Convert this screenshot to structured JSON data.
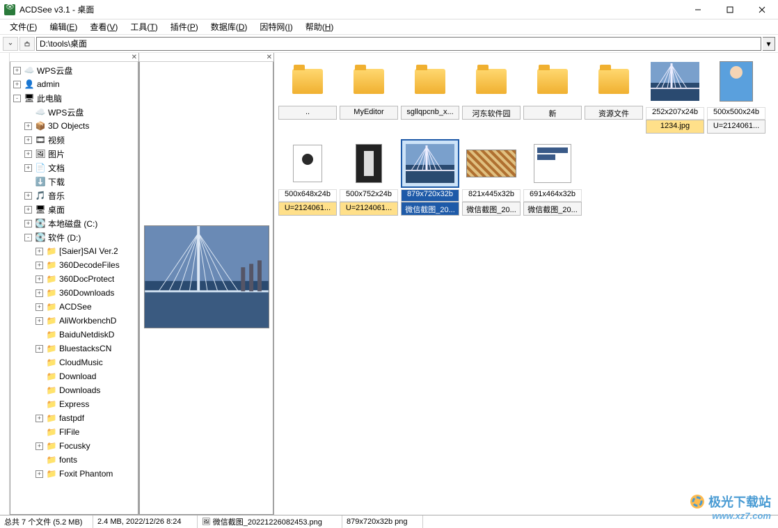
{
  "window": {
    "title": "ACDSee v3.1 - 桌面"
  },
  "menu": [
    {
      "label": "文件",
      "key": "F"
    },
    {
      "label": "编辑",
      "key": "E"
    },
    {
      "label": "查看",
      "key": "V"
    },
    {
      "label": "工具",
      "key": "T"
    },
    {
      "label": "插件",
      "key": "P"
    },
    {
      "label": "数据库",
      "key": "D"
    },
    {
      "label": "因特网",
      "key": "I"
    },
    {
      "label": "帮助",
      "key": "H"
    }
  ],
  "address": "D:\\tools\\桌面",
  "tree": [
    {
      "exp": "+",
      "depth": 0,
      "icon": "cloud",
      "label": "WPS云盘"
    },
    {
      "exp": "+",
      "depth": 0,
      "icon": "user",
      "label": "admin"
    },
    {
      "exp": "-",
      "depth": 0,
      "icon": "pc",
      "label": "此电脑"
    },
    {
      "exp": " ",
      "depth": 1,
      "icon": "cloud",
      "label": "WPS云盘"
    },
    {
      "exp": "+",
      "depth": 1,
      "icon": "cube",
      "label": "3D Objects"
    },
    {
      "exp": "+",
      "depth": 1,
      "icon": "video",
      "label": "视频"
    },
    {
      "exp": "+",
      "depth": 1,
      "icon": "image",
      "label": "图片"
    },
    {
      "exp": "+",
      "depth": 1,
      "icon": "doc",
      "label": "文档"
    },
    {
      "exp": " ",
      "depth": 1,
      "icon": "down",
      "label": "下载"
    },
    {
      "exp": "+",
      "depth": 1,
      "icon": "music",
      "label": "音乐"
    },
    {
      "exp": "+",
      "depth": 1,
      "icon": "desk",
      "label": "桌面"
    },
    {
      "exp": "+",
      "depth": 1,
      "icon": "drive",
      "label": "本地磁盘 (C:)"
    },
    {
      "exp": "-",
      "depth": 1,
      "icon": "drive",
      "label": "软件 (D:)"
    },
    {
      "exp": "+",
      "depth": 2,
      "icon": "folder",
      "label": "[Saier]SAI Ver.2"
    },
    {
      "exp": "+",
      "depth": 2,
      "icon": "folder",
      "label": "360DecodeFiles"
    },
    {
      "exp": "+",
      "depth": 2,
      "icon": "folder",
      "label": "360DocProtect"
    },
    {
      "exp": "+",
      "depth": 2,
      "icon": "folder",
      "label": "360Downloads"
    },
    {
      "exp": "+",
      "depth": 2,
      "icon": "folder",
      "label": "ACDSee"
    },
    {
      "exp": "+",
      "depth": 2,
      "icon": "folder",
      "label": "AliWorkbenchD"
    },
    {
      "exp": " ",
      "depth": 2,
      "icon": "folder",
      "label": "BaiduNetdiskD"
    },
    {
      "exp": "+",
      "depth": 2,
      "icon": "folder",
      "label": "BluestacksCN"
    },
    {
      "exp": " ",
      "depth": 2,
      "icon": "folder",
      "label": "CloudMusic"
    },
    {
      "exp": " ",
      "depth": 2,
      "icon": "folder",
      "label": "Download"
    },
    {
      "exp": " ",
      "depth": 2,
      "icon": "folder",
      "label": "Downloads"
    },
    {
      "exp": " ",
      "depth": 2,
      "icon": "folder",
      "label": "Express"
    },
    {
      "exp": "+",
      "depth": 2,
      "icon": "folder",
      "label": "fastpdf"
    },
    {
      "exp": " ",
      "depth": 2,
      "icon": "folder",
      "label": "FlFile"
    },
    {
      "exp": "+",
      "depth": 2,
      "icon": "folder",
      "label": "Focusky"
    },
    {
      "exp": " ",
      "depth": 2,
      "icon": "folder",
      "label": "fonts"
    },
    {
      "exp": "+",
      "depth": 2,
      "icon": "folder",
      "label": "Foxit Phantom"
    }
  ],
  "thumbs_row1": [
    {
      "type": "folder",
      "name": "..",
      "dim": ""
    },
    {
      "type": "folder",
      "name": "MyEditor",
      "dim": ""
    },
    {
      "type": "folder",
      "name": "sgllqpcnb_x...",
      "dim": ""
    },
    {
      "type": "folder",
      "name": "河东软件园",
      "dim": ""
    },
    {
      "type": "folder",
      "name": "新",
      "dim": ""
    },
    {
      "type": "folder",
      "name": "资源文件",
      "dim": ""
    },
    {
      "type": "bridge",
      "name": "1234.jpg",
      "dim": "252x207x24b",
      "hl": true
    },
    {
      "type": "girl",
      "name": "U=2124061...",
      "dim": "500x500x24b"
    }
  ],
  "thumbs_row2": [
    {
      "type": "portrait",
      "name": "U=2124061...",
      "dim": "500x648x24b",
      "hl": true
    },
    {
      "type": "statue",
      "name": "U=2124061...",
      "dim": "500x752x24b",
      "hl": true
    },
    {
      "type": "bridge",
      "name": "微信截图_20...",
      "dim": "879x720x32b",
      "selected": true
    },
    {
      "type": "collage",
      "name": "微信截图_20...",
      "dim": "821x445x32b"
    },
    {
      "type": "doc",
      "name": "微信截图_20...",
      "dim": "691x464x32b"
    }
  ],
  "status": {
    "total": "总共 7 个文件 (5.2 MB)",
    "file": "2.4 MB, 2022/12/26 8:24",
    "name": "微信截图_20221226082453.png",
    "dims": "879x720x32b png"
  },
  "watermark": {
    "title": "极光下载站",
    "url": "www.xz7.com"
  }
}
